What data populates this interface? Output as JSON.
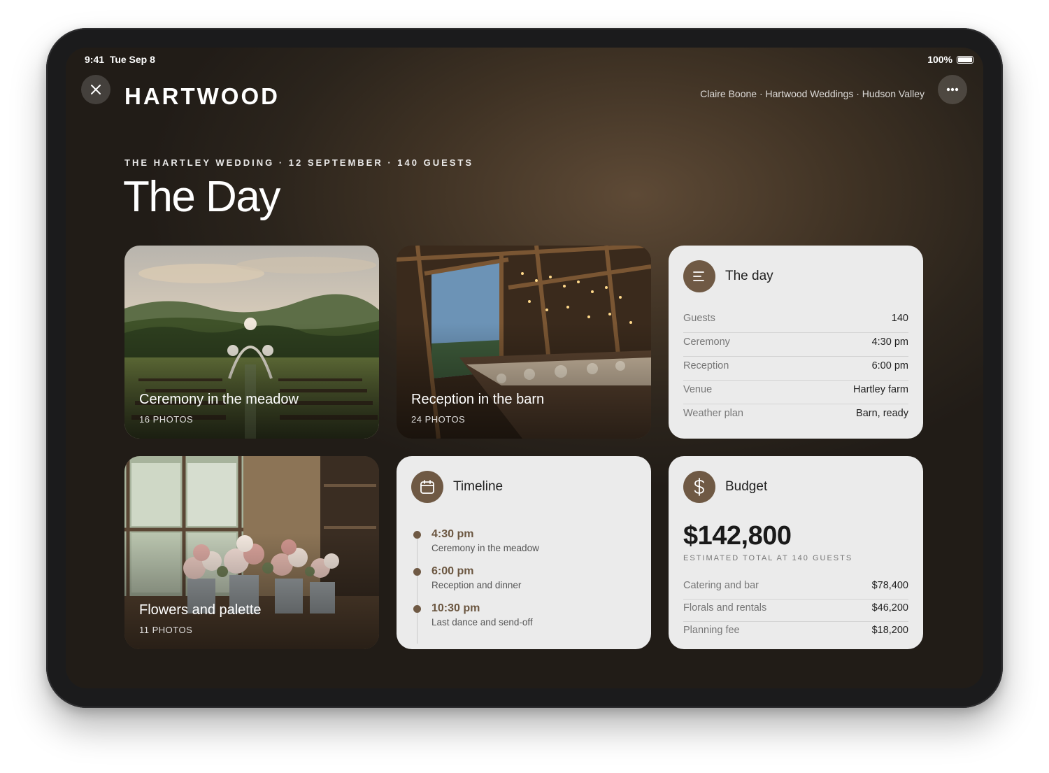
{
  "status_bar": {
    "time": "9:41",
    "date": "Tue Sep 8",
    "battery": "100%"
  },
  "header": {
    "logo": "HARTWOOD",
    "byline": "Claire Boone · Hartwood Weddings · Hudson Valley"
  },
  "hero": {
    "eyebrow": "THE HARTLEY WEDDING · 12 SEPTEMBER · 140 GUESTS",
    "title": "The Day"
  },
  "albums": [
    {
      "title": "Ceremony in the meadow",
      "count": "16 PHOTOS"
    },
    {
      "title": "Reception in the barn",
      "count": "24 PHOTOS"
    },
    {
      "title": "Flowers and palette",
      "count": "11 PHOTOS"
    }
  ],
  "day_card": {
    "title": "The day",
    "icon": "menu-lines-icon",
    "rows": [
      {
        "label": "Guests",
        "value": "140"
      },
      {
        "label": "Ceremony",
        "value": "4:30 pm"
      },
      {
        "label": "Reception",
        "value": "6:00 pm"
      },
      {
        "label": "Venue",
        "value": "Hartley farm"
      },
      {
        "label": "Weather plan",
        "value": "Barn, ready"
      }
    ]
  },
  "timeline_card": {
    "title": "Timeline",
    "icon": "calendar-icon",
    "items": [
      {
        "time": "4:30 pm",
        "desc": "Ceremony in the meadow"
      },
      {
        "time": "6:00 pm",
        "desc": "Reception and dinner"
      },
      {
        "time": "10:30 pm",
        "desc": "Last dance and send-off"
      }
    ]
  },
  "budget_card": {
    "title": "Budget",
    "icon": "dollar-icon",
    "total": "$142,800",
    "subtitle": "ESTIMATED TOTAL AT 140 GUESTS",
    "rows": [
      {
        "label": "Catering and bar",
        "value": "$78,400"
      },
      {
        "label": "Florals and rentals",
        "value": "$46,200"
      },
      {
        "label": "Planning fee",
        "value": "$18,200"
      }
    ]
  },
  "colors": {
    "accent": "#6f5944",
    "card_bg": "#ebebeb",
    "screen_bg": "#3f3224"
  }
}
